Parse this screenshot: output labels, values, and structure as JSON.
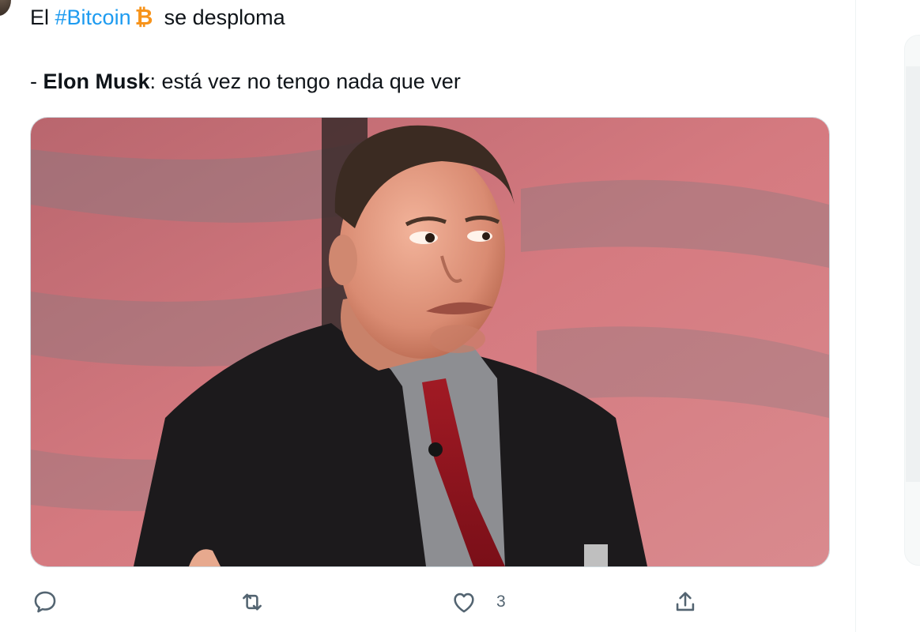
{
  "tweet": {
    "line1": {
      "prefix": "El",
      "hashtag": "#Bitcoin",
      "suffix": "se desploma"
    },
    "line2": {
      "dash": "-",
      "name": "Elon Musk",
      "rest": ": está vez no tengo nada que ver"
    },
    "media": {
      "subject": "photo-of-man-in-suit-grimacing"
    }
  },
  "actions": {
    "reply": {
      "icon": "reply-icon"
    },
    "retweet": {
      "icon": "retweet-icon"
    },
    "like": {
      "icon": "heart-icon",
      "count": "3"
    },
    "share": {
      "icon": "share-icon"
    }
  },
  "colors": {
    "hashtag": "#1d9bf0",
    "bitcoin": "#f7931a",
    "icon_gray": "#536471"
  }
}
